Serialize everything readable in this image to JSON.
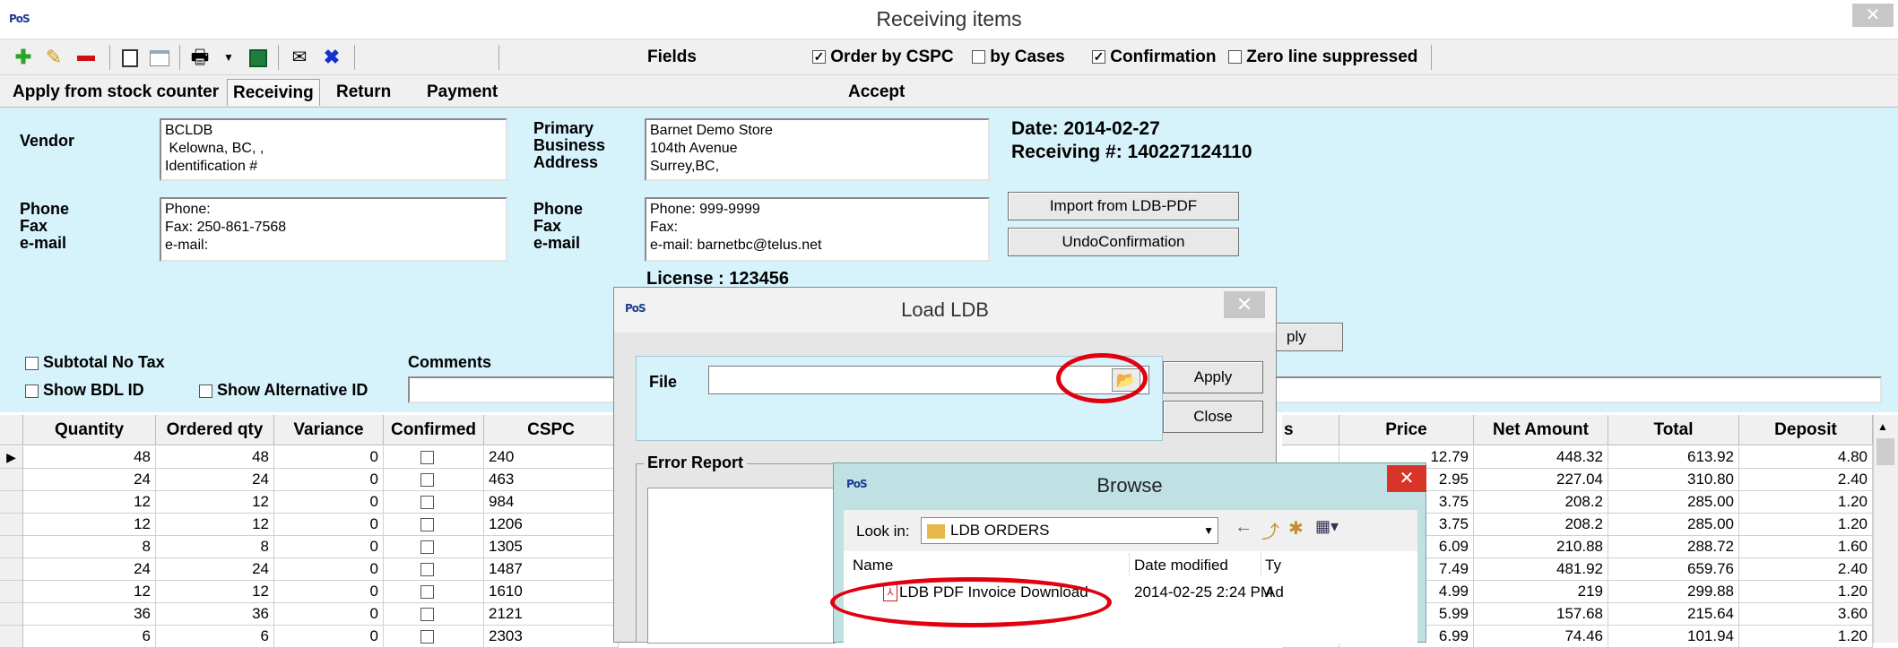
{
  "window": {
    "title": "Receiving items",
    "logo": "PoS",
    "close_label": "✕"
  },
  "toolbar": {
    "icons": [
      "add-icon",
      "edit-icon",
      "delete-icon",
      "preview-icon",
      "window-icon",
      "print-icon",
      "dropdown-arrow-icon",
      "excel-icon",
      "email-icon",
      "cancel-icon"
    ],
    "fields_label": "Fields",
    "checkboxes": [
      {
        "label": "Order by CSPC",
        "checked": true
      },
      {
        "label": "by Cases",
        "checked": false
      },
      {
        "label": "Confirmation",
        "checked": true
      },
      {
        "label": "Zero line suppressed",
        "checked": false
      }
    ]
  },
  "tabs": {
    "items": [
      "Apply from stock counter",
      "Receiving",
      "Return",
      "Payment"
    ],
    "active": "Receiving",
    "accept_label": "Accept"
  },
  "vendor": {
    "label": "Vendor",
    "text": "BCLDB\n Kelowna, BC, ,\nIdentification #",
    "contact_label": "Phone\nFax\ne-mail",
    "contact_text": "Phone:\nFax: 250-861-7568\ne-mail:"
  },
  "store": {
    "label": "Primary\nBusiness\nAddress",
    "text": "Barnet Demo Store\n104th Avenue\nSurrey,BC,",
    "contact_label": "Phone\nFax\ne-mail",
    "contact_text": "Phone: 999-9999\nFax:\ne-mail: barnetbc@telus.net",
    "license": "License :  123456"
  },
  "receipt": {
    "date": "Date: 2014-02-27",
    "number": "Receiving #: 140227124110"
  },
  "buttons": {
    "import": "Import from LDB-PDF",
    "undo": "UndoConfirmation",
    "apply_partial": "ply"
  },
  "options": {
    "subtotal_no_tax": "Subtotal No Tax",
    "show_bdl_id": "Show BDL ID",
    "show_alt_id": "Show Alternative ID",
    "comments_label": "Comments"
  },
  "grid": {
    "columns_left": [
      "Quantity",
      "Ordered qty",
      "Variance",
      "Confirmed",
      "CSPC"
    ],
    "columns_right": [
      "s",
      "Price",
      "Net Amount",
      "Total",
      "Deposit"
    ],
    "rows": [
      {
        "qty": "48",
        "ordered": "48",
        "variance": "0",
        "cspc": "240",
        "price": "12.79",
        "net": "448.32",
        "total": "613.92",
        "deposit": "4.80"
      },
      {
        "qty": "24",
        "ordered": "24",
        "variance": "0",
        "cspc": "463",
        "price": "2.95",
        "net": "227.04",
        "total": "310.80",
        "deposit": "2.40"
      },
      {
        "qty": "12",
        "ordered": "12",
        "variance": "0",
        "cspc": "984",
        "price": "3.75",
        "net": "208.2",
        "total": "285.00",
        "deposit": "1.20"
      },
      {
        "qty": "12",
        "ordered": "12",
        "variance": "0",
        "cspc": "1206",
        "price": "3.75",
        "net": "208.2",
        "total": "285.00",
        "deposit": "1.20"
      },
      {
        "qty": "8",
        "ordered": "8",
        "variance": "0",
        "cspc": "1305",
        "price": "6.09",
        "net": "210.88",
        "total": "288.72",
        "deposit": "1.60"
      },
      {
        "qty": "24",
        "ordered": "24",
        "variance": "0",
        "cspc": "1487",
        "price": "7.49",
        "net": "481.92",
        "total": "659.76",
        "deposit": "2.40"
      },
      {
        "qty": "12",
        "ordered": "12",
        "variance": "0",
        "cspc": "1610",
        "price": "4.99",
        "net": "219",
        "total": "299.88",
        "deposit": "1.20"
      },
      {
        "qty": "36",
        "ordered": "36",
        "variance": "0",
        "cspc": "2121",
        "price": "5.99",
        "net": "157.68",
        "total": "215.64",
        "deposit": "3.60"
      },
      {
        "qty": "6",
        "ordered": "6",
        "variance": "0",
        "cspc": "2303",
        "price": "6.99",
        "net": "74.46",
        "total": "101.94",
        "deposit": "1.20"
      }
    ]
  },
  "load_dialog": {
    "logo": "PoS",
    "title": "Load LDB",
    "close_label": "✕",
    "file_label": "File",
    "file_value": "",
    "apply_label": "Apply",
    "close_button": "Close",
    "error_report_label": "Error Report"
  },
  "browse_dialog": {
    "logo": "PoS",
    "title": "Browse",
    "close_label": "✕",
    "look_in_label": "Look in:",
    "look_in_value": "LDB ORDERS",
    "col_name": "Name",
    "col_date": "Date modified",
    "col_type": "Ty",
    "file_name": "LDB PDF Invoice Download",
    "file_date": "2014-02-25 2:24 PM",
    "file_type": "Ad"
  }
}
